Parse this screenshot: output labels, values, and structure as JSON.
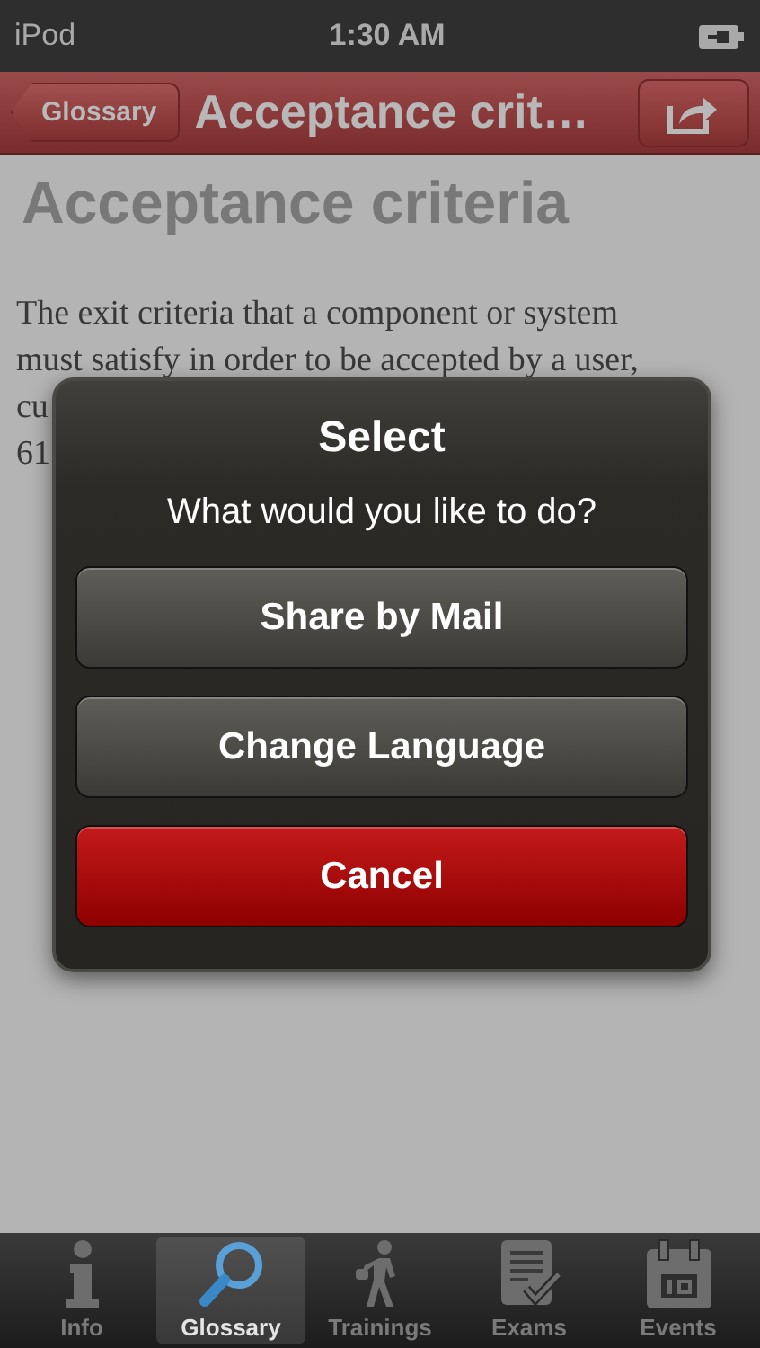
{
  "status_bar": {
    "carrier": "iPod",
    "time": "1:30 AM"
  },
  "nav_bar": {
    "back": "Glossary",
    "title": "Acceptance crit…"
  },
  "article": {
    "heading": "Acceptance criteria",
    "lines": [
      "The exit criteria that a component or system",
      "must satisfy in order to be accepted by a user,",
      "cu",
      "61"
    ]
  },
  "alert": {
    "title": "Select",
    "message": "What would you like to do?",
    "buttons": [
      {
        "label": "Share by Mail",
        "kind": "default"
      },
      {
        "label": "Change Language",
        "kind": "default"
      },
      {
        "label": "Cancel",
        "kind": "destructive"
      }
    ]
  },
  "tab_bar": [
    {
      "label": "Info",
      "kind": "info",
      "selected": false
    },
    {
      "label": "Glossary",
      "kind": "search",
      "selected": true
    },
    {
      "label": "Trainings",
      "kind": "walker",
      "selected": false
    },
    {
      "label": "Exams",
      "kind": "exam",
      "selected": false
    },
    {
      "label": "Events",
      "kind": "calendar",
      "selected": false
    }
  ]
}
